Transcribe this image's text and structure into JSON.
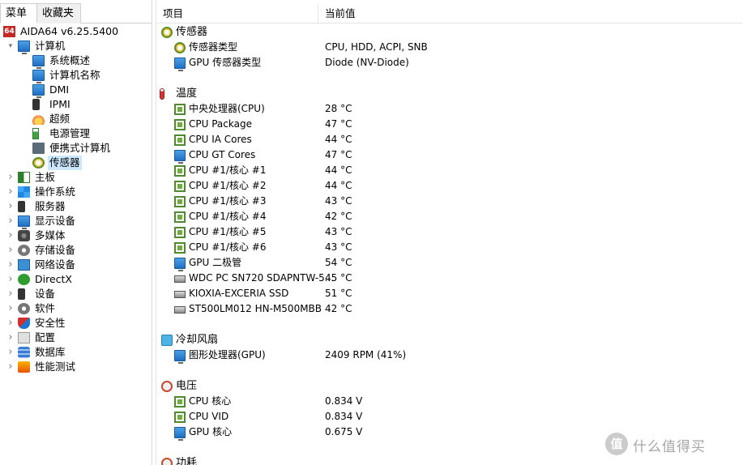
{
  "tabs": {
    "menu": "菜单",
    "favorites": "收藏夹"
  },
  "tree": [
    {
      "label": "AIDA64 v6.25.5400",
      "icon": "aida64-icon",
      "exp": ""
    },
    {
      "label": "计算机",
      "icon": "computer-icon",
      "exp": "expanded"
    },
    {
      "label": "系统概述",
      "icon": "monitor-icon",
      "exp": ""
    },
    {
      "label": "计算机名称",
      "icon": "monitor-icon",
      "exp": ""
    },
    {
      "label": "DMI",
      "icon": "monitor-icon",
      "exp": ""
    },
    {
      "label": "IPMI",
      "icon": "phone-icon",
      "exp": ""
    },
    {
      "label": "超频",
      "icon": "fire-icon",
      "exp": ""
    },
    {
      "label": "电源管理",
      "icon": "battery-icon",
      "exp": ""
    },
    {
      "label": "便携式计算机",
      "icon": "laptop-icon",
      "exp": ""
    },
    {
      "label": "传感器",
      "icon": "sensor-gauge-icon",
      "exp": ""
    },
    {
      "label": "主板",
      "icon": "motherboard-icon",
      "exp": "collapsed"
    },
    {
      "label": "操作系统",
      "icon": "windows-icon",
      "exp": "collapsed"
    },
    {
      "label": "服务器",
      "icon": "server-icon",
      "exp": "collapsed"
    },
    {
      "label": "显示设备",
      "icon": "display-icon",
      "exp": "collapsed"
    },
    {
      "label": "多媒体",
      "icon": "speaker-icon",
      "exp": "collapsed"
    },
    {
      "label": "存储设备",
      "icon": "storage-icon",
      "exp": "collapsed"
    },
    {
      "label": "网络设备",
      "icon": "network-icon",
      "exp": "collapsed"
    },
    {
      "label": "DirectX",
      "icon": "xbox-icon",
      "exp": "collapsed"
    },
    {
      "label": "设备",
      "icon": "device-icon",
      "exp": "collapsed"
    },
    {
      "label": "软件",
      "icon": "software-icon",
      "exp": "collapsed"
    },
    {
      "label": "安全性",
      "icon": "shield-icon",
      "exp": "collapsed"
    },
    {
      "label": "配置",
      "icon": "config-gear-icon",
      "exp": "collapsed"
    },
    {
      "label": "数据库",
      "icon": "database-icon",
      "exp": "collapsed"
    },
    {
      "label": "性能测试",
      "icon": "benchmark-icon",
      "exp": "collapsed"
    }
  ],
  "columns": {
    "item": "项目",
    "value": "当前值"
  },
  "rows": [
    {
      "kind": "cat",
      "name": "传感器",
      "icon": "sensor-gauge-icon",
      "value": ""
    },
    {
      "kind": "item",
      "name": "传感器类型",
      "icon": "sensor-gauge-icon",
      "value": "CPU, HDD, ACPI, SNB"
    },
    {
      "kind": "item",
      "name": "GPU 传感器类型",
      "icon": "monitor-icon",
      "value": "Diode  (NV-Diode)"
    },
    {
      "kind": "gap"
    },
    {
      "kind": "cat",
      "name": "温度",
      "icon": "thermometer-icon",
      "value": ""
    },
    {
      "kind": "item",
      "name": "中央处理器(CPU)",
      "icon": "chip-icon",
      "value": "28 °C"
    },
    {
      "kind": "item",
      "name": "CPU Package",
      "icon": "chip-icon",
      "value": "47 °C"
    },
    {
      "kind": "item",
      "name": "CPU IA Cores",
      "icon": "chip-icon",
      "value": "44 °C"
    },
    {
      "kind": "item",
      "name": "CPU GT Cores",
      "icon": "monitor-icon",
      "value": "47 °C"
    },
    {
      "kind": "item",
      "name": "CPU #1/核心 #1",
      "icon": "chip-icon",
      "value": "44 °C"
    },
    {
      "kind": "item",
      "name": "CPU #1/核心 #2",
      "icon": "chip-icon",
      "value": "44 °C"
    },
    {
      "kind": "item",
      "name": "CPU #1/核心 #3",
      "icon": "chip-icon",
      "value": "43 °C"
    },
    {
      "kind": "item",
      "name": "CPU #1/核心 #4",
      "icon": "chip-icon",
      "value": "42 °C"
    },
    {
      "kind": "item",
      "name": "CPU #1/核心 #5",
      "icon": "chip-icon",
      "value": "43 °C"
    },
    {
      "kind": "item",
      "name": "CPU #1/核心 #6",
      "icon": "chip-icon",
      "value": "43 °C"
    },
    {
      "kind": "item",
      "name": "GPU 二极管",
      "icon": "monitor-icon",
      "value": "54 °C"
    },
    {
      "kind": "item",
      "name": "WDC PC SN720 SDAPNTW-5...",
      "icon": "drive-icon",
      "value": "45 °C"
    },
    {
      "kind": "item",
      "name": "KIOXIA-EXCERIA SSD",
      "icon": "drive-icon",
      "value": "51 °C"
    },
    {
      "kind": "item",
      "name": "ST500LM012 HN-M500MBB",
      "icon": "drive-icon",
      "value": "42 °C"
    },
    {
      "kind": "gap"
    },
    {
      "kind": "cat",
      "name": "冷却风扇",
      "icon": "fan-icon",
      "value": ""
    },
    {
      "kind": "item",
      "name": "图形处理器(GPU)",
      "icon": "monitor-icon",
      "value": "2409 RPM  (41%)"
    },
    {
      "kind": "gap"
    },
    {
      "kind": "cat",
      "name": "电压",
      "icon": "voltage-icon",
      "value": ""
    },
    {
      "kind": "item",
      "name": "CPU 核心",
      "icon": "chip-icon",
      "value": "0.834 V"
    },
    {
      "kind": "item",
      "name": "CPU VID",
      "icon": "chip-icon",
      "value": "0.834 V"
    },
    {
      "kind": "item",
      "name": "GPU 核心",
      "icon": "monitor-icon",
      "value": "0.675 V"
    },
    {
      "kind": "gap"
    },
    {
      "kind": "cat",
      "name": "功耗",
      "icon": "voltage-icon",
      "value": ""
    }
  ],
  "watermark": {
    "glyph": "值",
    "text": "什么值得买"
  }
}
